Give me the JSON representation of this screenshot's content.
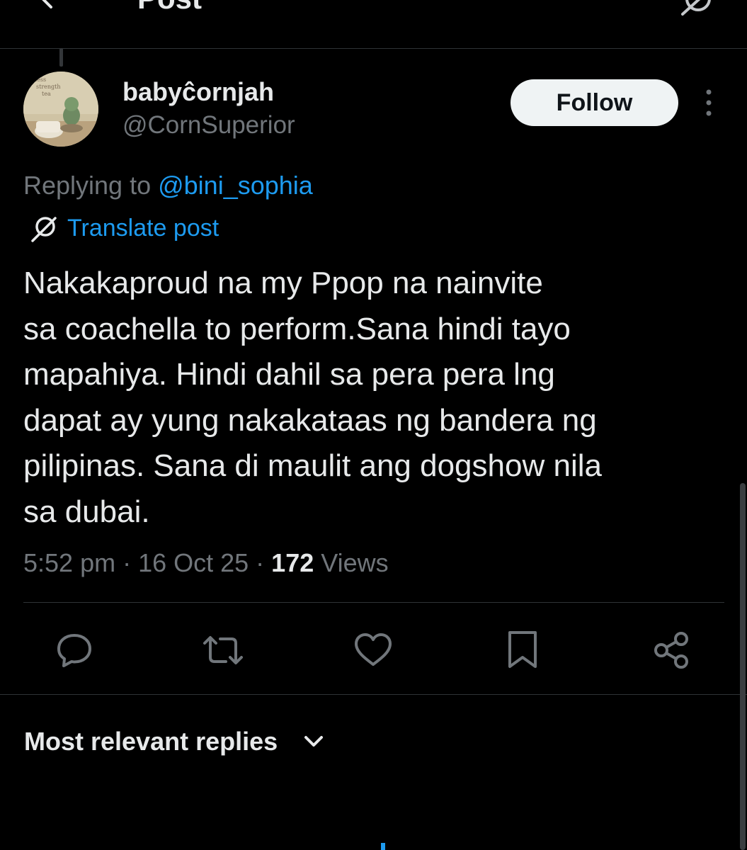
{
  "header": {
    "title": "Post"
  },
  "author": {
    "display_name": "babyĉornjah",
    "handle": "@CornSuperior",
    "follow_label": "Follow"
  },
  "reply_context": {
    "prefix": "Replying to ",
    "mention": "@bini_sophia"
  },
  "translate_label": "Translate post",
  "post": {
    "lines": [
      "Nakakaproud na my Ppop na nainvite",
      "sa coachella to perform.Sana hindi tayo",
      "mapahiya. Hindi dahil sa pera pera lng",
      "dapat ay yung nakakataas ng bandera ng",
      "pilipinas. Sana di maulit ang dogshow nila",
      "sa dubai."
    ]
  },
  "meta": {
    "time": "5:52 pm",
    "separator": " · ",
    "date": "16 Oct 25",
    "views_count": "172",
    "views_label": " Views"
  },
  "actions": {
    "icons": [
      "reply-icon",
      "repost-icon",
      "like-icon",
      "bookmark-icon",
      "share-icon"
    ]
  },
  "replies_sort": {
    "label": "Most relevant replies"
  },
  "colors": {
    "background": "#000000",
    "text_primary": "#e7e9ea",
    "text_secondary": "#71767b",
    "accent": "#1d9bf0",
    "divider": "#2f3336",
    "follow_bg": "#eff3f4"
  }
}
